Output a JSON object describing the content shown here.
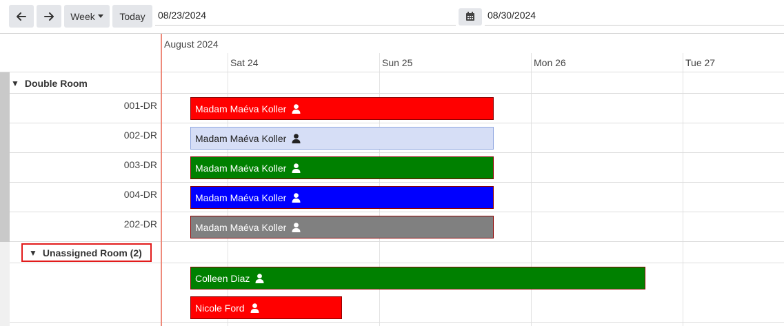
{
  "toolbar": {
    "prev_icon": "arrow-left-icon",
    "next_icon": "arrow-right-icon",
    "week_label": "Week",
    "today_label": "Today",
    "start_date": "08/23/2024",
    "end_date": "08/30/2024",
    "calendar_icon": "calendar-icon"
  },
  "timeline": {
    "month": "August 2024",
    "days": [
      "Sat 24",
      "Sun 25",
      "Mon 26",
      "Tue 27"
    ]
  },
  "groups": {
    "double_room": {
      "title": "Double Room",
      "toggle_icon": "triangle-down-icon"
    },
    "unassigned": {
      "title": "Unassigned Room (2)",
      "toggle_icon": "triangle-down-icon"
    }
  },
  "rooms": [
    "001-DR",
    "002-DR",
    "003-DR",
    "004-DR",
    "202-DR"
  ],
  "bookings": [
    {
      "label": "Madam Maéva Koller",
      "color": "#ff0000",
      "text_color": "#ffffff",
      "icon": "user-icon"
    },
    {
      "label": "Madam Maéva Koller",
      "color": "#d6def6",
      "text_color": "#222222",
      "icon": "user-icon"
    },
    {
      "label": "Madam Maéva Koller",
      "color": "#008000",
      "text_color": "#ffffff",
      "icon": "user-icon"
    },
    {
      "label": "Madam Maéva Koller",
      "color": "#0000ff",
      "text_color": "#ffffff",
      "icon": "user-icon"
    },
    {
      "label": "Madam Maéva Koller",
      "color": "#808080",
      "text_color": "#ffffff",
      "icon": "user-icon"
    },
    {
      "label": "Colleen Diaz",
      "color": "#008000",
      "text_color": "#ffffff",
      "icon": "user-icon"
    },
    {
      "label": "Nicole Ford",
      "color": "#ff0000",
      "text_color": "#ffffff",
      "icon": "user-icon"
    }
  ]
}
